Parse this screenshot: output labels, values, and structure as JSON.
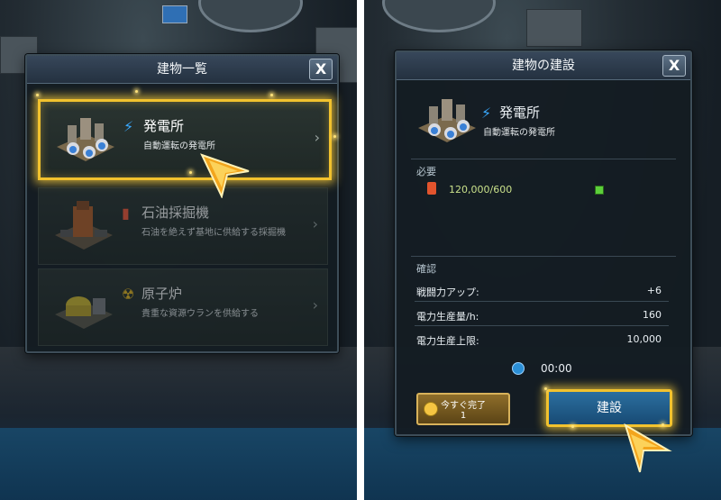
{
  "left_panel": {
    "title": "建物一覧",
    "close_label": "X",
    "items": [
      {
        "name": "発電所",
        "description": "自動運転の発電所",
        "type_icon": "lightning-icon",
        "selected": true
      },
      {
        "name": "石油採掘機",
        "description": "石油を絶えず基地に供給する採掘機",
        "type_icon": "oil-can-icon",
        "selected": false
      },
      {
        "name": "原子炉",
        "description": "貴重な資源ウランを供給する",
        "type_icon": "radiation-icon",
        "selected": false
      }
    ],
    "chevron": "›"
  },
  "right_panel": {
    "title": "建物の建設",
    "close_label": "X",
    "building": {
      "name": "発電所",
      "description": "自動運転の発電所",
      "type_icon": "lightning-icon"
    },
    "requirements": {
      "label": "必要",
      "resource_icon": "oil-can-icon",
      "amount": "120,000/600",
      "status_icon": "check-box-icon"
    },
    "confirm": {
      "label": "確認",
      "stats": [
        {
          "label": "戦闘力アップ:",
          "value": "+6"
        },
        {
          "label": "電力生産量/h:",
          "value": "160"
        },
        {
          "label": "電力生産上限:",
          "value": "10,000"
        }
      ],
      "time_icon": "clock-icon",
      "time": "00:00"
    },
    "instant_button": {
      "label": "今すぐ完了",
      "cost": "1",
      "icon": "gold-coins-icon"
    },
    "build_button": {
      "label": "建設"
    }
  },
  "colors": {
    "highlight": "#f2c22e",
    "accent_blue": "#1f5f8f",
    "value_text": "#e8eef2"
  }
}
